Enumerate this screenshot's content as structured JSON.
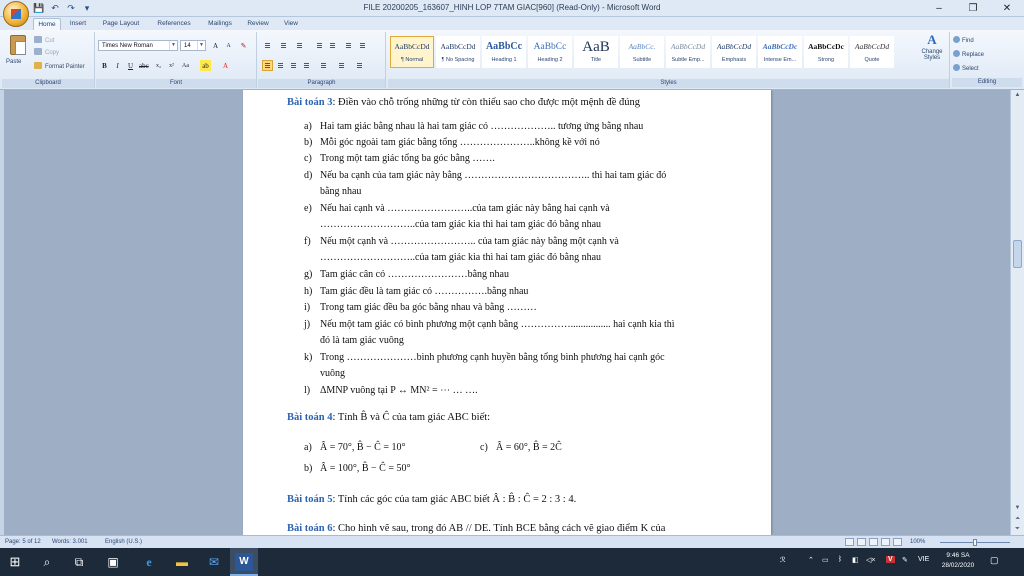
{
  "window": {
    "title": "FILE 20200205_163607_HINH LOP 7TAM GIAC[960] (Read-Only) - Microsoft Word",
    "minimize": "–",
    "restore": "❐",
    "close": "✕"
  },
  "qat": [
    "💾",
    "↶",
    "↷",
    "▾"
  ],
  "tabs": [
    "Home",
    "Insert",
    "Page Layout",
    "References",
    "Mailings",
    "Review",
    "View"
  ],
  "ribbon": {
    "clipboard": {
      "paste": "Paste",
      "cut": "Cut",
      "copy": "Copy",
      "format_painter": "Format Painter",
      "label": "Clipboard"
    },
    "font": {
      "name": "Times New Roman",
      "size": "14",
      "label": "Font"
    },
    "paragraph": {
      "label": "Paragraph"
    },
    "styles": {
      "label": "Styles",
      "items": [
        {
          "preview": "AaBbCcDd",
          "name": "¶ Normal"
        },
        {
          "preview": "AaBbCcDd",
          "name": "¶ No Spacing"
        },
        {
          "preview": "AaBbCc",
          "name": "Heading 1"
        },
        {
          "preview": "AaBbCc",
          "name": "Heading 2"
        },
        {
          "preview": "AaB",
          "name": "Title"
        },
        {
          "preview": "AaBbCc.",
          "name": "Subtitle"
        },
        {
          "preview": "AaBbCcDd",
          "name": "Subtle Emp..."
        },
        {
          "preview": "AaBbCcDd",
          "name": "Emphasis"
        },
        {
          "preview": "AaBbCcDc",
          "name": "Intense Em..."
        },
        {
          "preview": "AaBbCcDc",
          "name": "Strong"
        },
        {
          "preview": "AaBbCcDd",
          "name": "Quote"
        }
      ],
      "change_styles": "Change Styles"
    },
    "editing": {
      "find": "Find",
      "replace": "Replace",
      "select": "Select",
      "label": "Editing"
    }
  },
  "document": {
    "bt3_title": "Bài toán 3",
    "bt3_text": ": Điền vào chỗ trống những từ còn thiếu sao cho được một mệnh đề đúng",
    "items": [
      {
        "label": "a)",
        "text": "Hai tam giác bằng nhau là hai tam giác có ……………….. tương ứng bằng nhau"
      },
      {
        "label": "b)",
        "text": "Mỗi góc ngoài tam giác bằng tổng …………………..không kề với nó"
      },
      {
        "label": "c)",
        "text": "Trong một tam giác tổng ba góc bằng ……."
      },
      {
        "label": "d)",
        "text": "Nếu ba cạnh của tam giác này bằng ……………………………….. thì hai tam giác đó"
      },
      {
        "label": "",
        "text": "bằng nhau"
      },
      {
        "label": "e)",
        "text": "Nếu hai cạnh và ……………………..của tam giác này bằng hai cạnh và"
      },
      {
        "label": "",
        "text": "………………………..của tam giác kia thì hai tam giác đó bằng nhau"
      },
      {
        "label": "f)",
        "text": "Nếu một cạnh và …………………….. của tam giác này bằng một cạnh và"
      },
      {
        "label": "",
        "text": "………………………..của tam giác kia thì hai tam giác đó bằng nhau"
      },
      {
        "label": "g)",
        "text": "Tam giác cân có ……………………bằng nhau"
      },
      {
        "label": "h)",
        "text": "Tam giác đều là tam giác có …………….bằng nhau"
      },
      {
        "label": "i)",
        "text": "Trong tam giác đều ba góc bằng nhau và bằng ………"
      },
      {
        "label": "j)",
        "text": "Nếu một tam giác có bình phương một cạnh bằng ……………................ hai cạnh kia thì"
      },
      {
        "label": "",
        "text": "đó là tam giác vuông"
      },
      {
        "label": "k)",
        "text": "Trong …………………bình phương cạnh huyền bằng tổng bình phương hai cạnh góc"
      },
      {
        "label": "",
        "text": "vuông"
      },
      {
        "label": "l)",
        "text": "ΔMNP vuông tại P ↔ MN² = ⋯ … …."
      }
    ],
    "bt4_title": "Bài toán 4",
    "bt4_text": ": Tính B̂ và Ĉ của tam giác ABC biết:",
    "bt4_a": "Â = 70°, B̂ − Ĉ = 10°",
    "bt4_c": "Â = 60°, B̂ = 2Ĉ",
    "bt4_b": "Â = 100°, B̂ − Ĉ = 50°",
    "bt5_title": "Bài toán 5",
    "bt5_text": ": Tính các góc của tam giác ABC biết  Â : B̂ : Ĉ = 2 : 3 : 4.",
    "bt6_title": "Bài toán 6",
    "bt6_text": ": Cho hình vẽ sau, trong đó AB // DE. Tính BCE bằng cách vẽ giao điểm K của"
  },
  "status": {
    "page": "Page: 5 of 12",
    "words": "Words: 3.001",
    "language": "English (U.S.)",
    "zoom": "100%"
  },
  "taskbar": {
    "time": "9:46 SA",
    "date": "28/02/2020",
    "lang": "VIE"
  }
}
